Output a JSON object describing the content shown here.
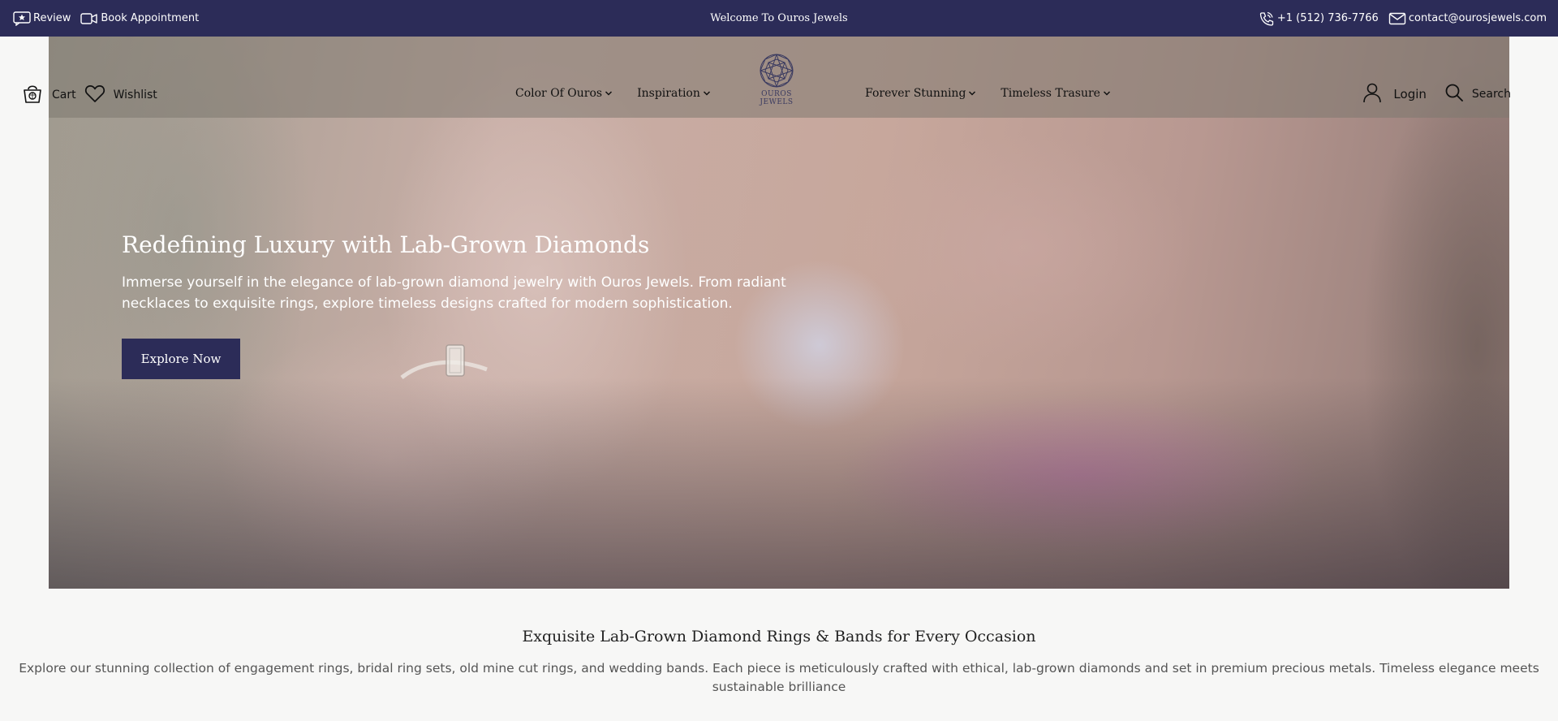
{
  "topbar": {
    "review_label": "Review",
    "book_label": "Book Appointment",
    "welcome": "Welcome To Ouros Jewels",
    "phone": "+1 (512) 736-7766",
    "email": "contact@ourosjewels.com"
  },
  "nav": {
    "cart_label": "Cart",
    "wishlist_label": "Wishlist",
    "links_left": [
      "Color Of Ouros",
      "Inspiration"
    ],
    "links_right": [
      "Forever Stunning",
      "Timeless Trasure"
    ],
    "logo_text": "OUROS JEWELS",
    "login_label": "Login",
    "search_label": "Search"
  },
  "hero": {
    "title": "Redefining Luxury with Lab-Grown Diamonds",
    "text": "Immerse yourself in the elegance of lab-grown diamond jewelry with Ouros Jewels. From radiant necklaces to exquisite rings, explore timeless designs crafted for modern sophistication.",
    "cta_label": "Explore Now"
  },
  "section": {
    "title": "Exquisite Lab-Grown Diamond Rings & Bands for Every Occasion",
    "text": "Explore our stunning collection of engagement rings, bridal ring sets, old mine cut rings, and wedding bands. Each piece is meticulously crafted with ethical, lab-grown diamonds and set in premium precious metals. Timeless elegance meets sustainable brilliance"
  },
  "colors": {
    "brand_navy": "#2c2c58",
    "page_bg": "#f7f7f6"
  }
}
